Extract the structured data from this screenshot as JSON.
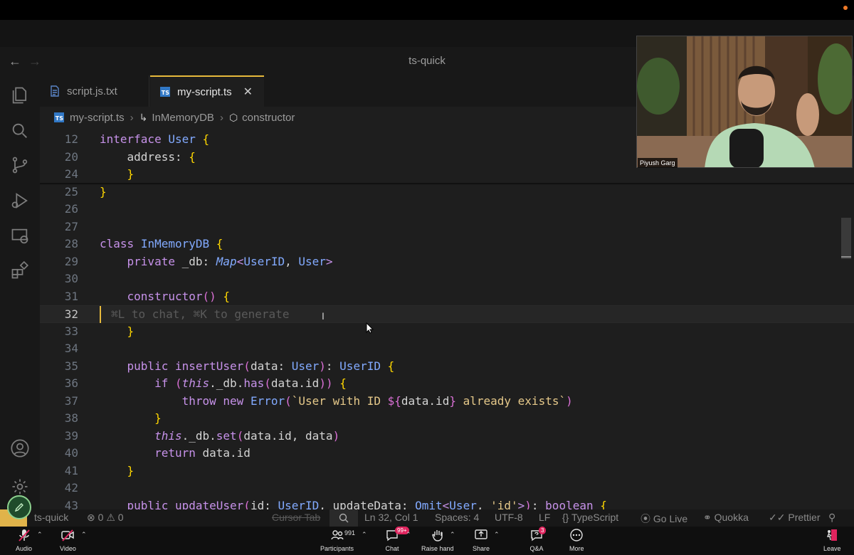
{
  "window": {
    "title": "ts-quick"
  },
  "tabs": [
    {
      "label": "script.js.txt",
      "active": false
    },
    {
      "label": "my-script.ts",
      "active": true
    }
  ],
  "breadcrumb": [
    "my-script.ts",
    "InMemoryDB",
    "constructor"
  ],
  "editor": {
    "language_color": "#3178c6",
    "inline_hint": "⌘L to chat, ⌘K to generate",
    "lines": [
      {
        "n": "12",
        "text": "interface User {"
      },
      {
        "n": "20",
        "text": "    address: {"
      },
      {
        "n": "24",
        "text": "    }"
      },
      {
        "n": "25",
        "text": "}"
      },
      {
        "n": "26",
        "text": ""
      },
      {
        "n": "27",
        "text": ""
      },
      {
        "n": "28",
        "text": "class InMemoryDB {"
      },
      {
        "n": "29",
        "text": "    private _db: Map<UserID, User>"
      },
      {
        "n": "30",
        "text": ""
      },
      {
        "n": "31",
        "text": "    constructor() {"
      },
      {
        "n": "32",
        "text": ""
      },
      {
        "n": "33",
        "text": "    }"
      },
      {
        "n": "34",
        "text": ""
      },
      {
        "n": "35",
        "text": "    public insertUser(data: User): UserID {"
      },
      {
        "n": "36",
        "text": "        if (this._db.has(data.id)) {"
      },
      {
        "n": "37",
        "text": "            throw new Error(`User with ID ${data.id} already exists`)"
      },
      {
        "n": "38",
        "text": "        }"
      },
      {
        "n": "39",
        "text": "        this._db.set(data.id, data)"
      },
      {
        "n": "40",
        "text": "        return data.id"
      },
      {
        "n": "41",
        "text": "    }"
      },
      {
        "n": "42",
        "text": ""
      },
      {
        "n": "43",
        "text": "    public updateUser(id: UserID, updateData: Omit<User, 'id'>): boolean {"
      }
    ]
  },
  "video": {
    "speaker_name": "Piyush Garg"
  },
  "statusbar": {
    "remote": "ts-quick",
    "errors": "0",
    "warnings": "0",
    "cursor_tab": "Cursor Tab",
    "position": "Ln 32, Col 1",
    "spaces": "Spaces: 4",
    "encoding": "UTF-8",
    "eol": "LF",
    "language": "TypeScript",
    "go_live": "Go Live",
    "quokka": "Quokka",
    "prettier": "Prettier"
  },
  "meeting_bar": {
    "audio": "Audio",
    "video": "Video",
    "participants": "Participants",
    "participants_count": "991",
    "chat": "Chat",
    "chat_badge": "99+",
    "raise_hand": "Raise hand",
    "share": "Share",
    "qa": "Q&A",
    "qa_badge": "3",
    "more": "More",
    "leave": "Leave"
  }
}
